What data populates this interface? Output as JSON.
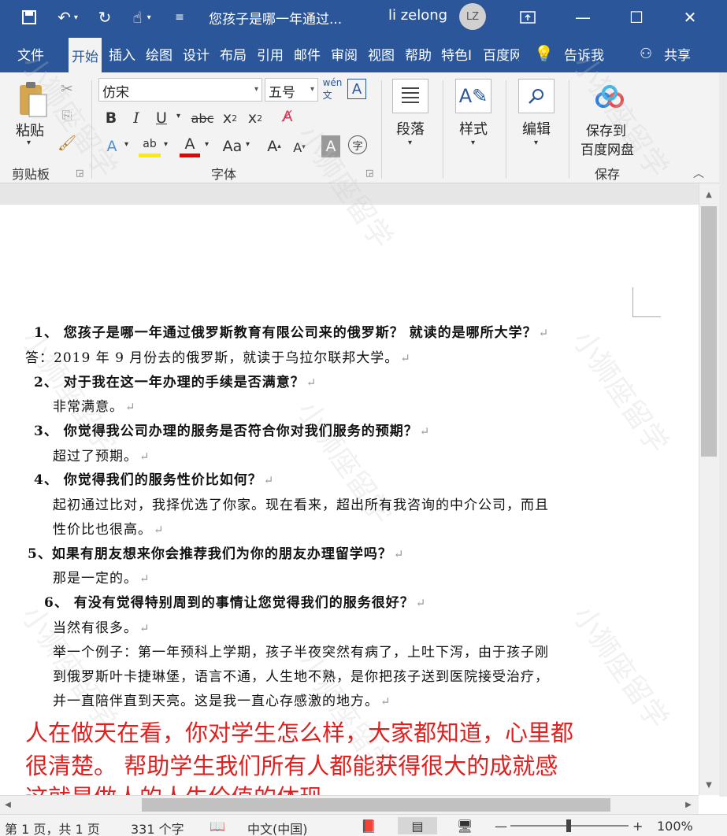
{
  "titlebar": {
    "doc_title": "您孩子是哪一年通过...",
    "user_name": "li zelong",
    "avatar_initials": "LZ"
  },
  "tabs": [
    "文件",
    "开始",
    "插入",
    "绘图",
    "设计",
    "布局",
    "引用",
    "邮件",
    "审阅",
    "视图",
    "帮助",
    "特色I",
    "百度网"
  ],
  "tell_me": "告诉我",
  "share": "共享",
  "ribbon": {
    "paste": "粘贴",
    "clipboard": "剪贴板",
    "font_name": "仿宋",
    "font_size": "五号",
    "font_group": "字体",
    "paragraph": "段落",
    "styles": "样式",
    "editing": "编辑",
    "save_to_baidu_1": "保存到",
    "save_to_baidu_2": "百度网盘",
    "save_group": "保存"
  },
  "document": {
    "q1": "1、 您孩子是哪一年通过俄罗斯教育有限公司来的俄罗斯？ 就读的是哪所大学？",
    "a1": "答：2019 年 9 月份去的俄罗斯，就读于乌拉尔联邦大学。",
    "q2": "2、 对于我在这一年办理的手续是否满意？",
    "a2": "非常满意。",
    "q3": "3、 你觉得我公司办理的服务是否符合你对我们服务的预期？",
    "a3": "超过了预期。",
    "q4": "4、 你觉得我们的服务性价比如何？",
    "a4_1": "起初通过比对，我择优选了你家。现在看来，超出所有我咨询的中介公司，而且",
    "a4_2": "性价比也很高。",
    "q5": "5、如果有朋友想来你会推荐我们为你的朋友办理留学吗？",
    "a5": "那是一定的。",
    "q6": "6、 有没有觉得特别周到的事情让您觉得我们的服务很好？",
    "a6_1": "当然有很多。",
    "a6_2": "举一个例子：第一年预科上学期，孩子半夜突然有病了，上吐下泻，由于孩子刚",
    "a6_3": "到俄罗斯叶卡捷琳堡，语言不通，人生地不熟，是你把孩子送到医院接受治疗，",
    "a6_4": "并一直陪伴直到天亮。这是我一直心存感激的地方。"
  },
  "overlay": {
    "line1": "人在做天在看，你对学生怎么样，大家都知道，心里都",
    "line2": "很清楚。 帮助学生我们所有人都能获得很大的成就感",
    "line3": "这就是做人的人生价值的体现。",
    "color": "#e21f1f"
  },
  "status": {
    "page": "第 1 页，共 1 页",
    "words": "331 个字",
    "language": "中文(中国)",
    "zoom": "100%"
  },
  "watermark": "小狮座留学"
}
